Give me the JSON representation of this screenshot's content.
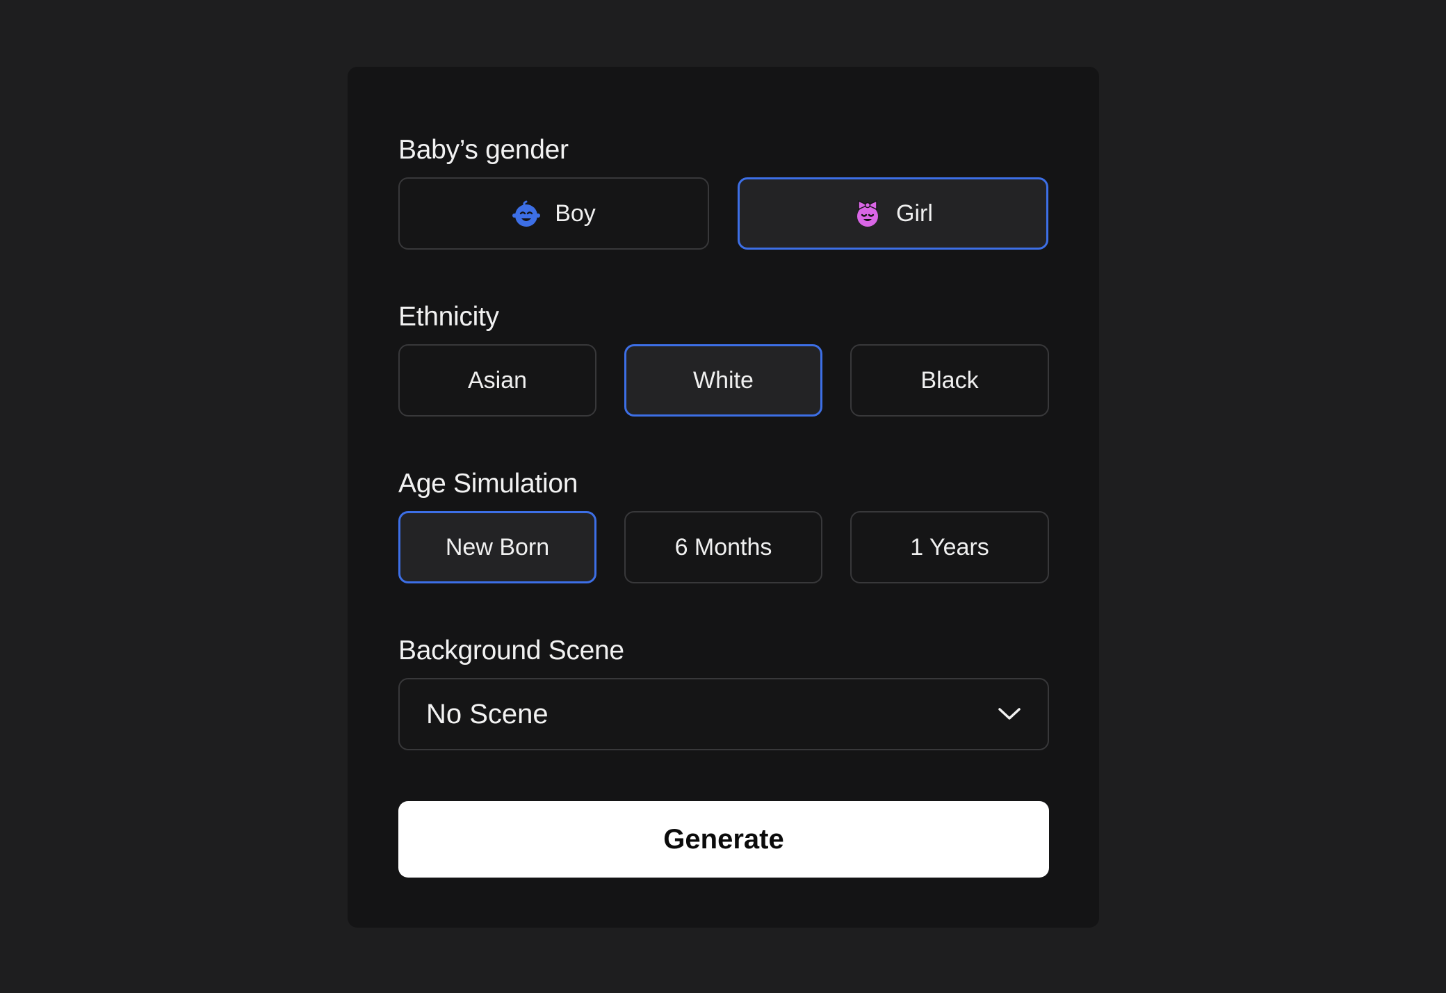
{
  "gender": {
    "label": "Baby’s gender",
    "options": [
      {
        "label": "Boy",
        "icon": "baby-boy-icon",
        "selected": false
      },
      {
        "label": "Girl",
        "icon": "baby-girl-icon",
        "selected": true
      }
    ]
  },
  "ethnicity": {
    "label": "Ethnicity",
    "options": [
      {
        "label": "Asian",
        "selected": false
      },
      {
        "label": "White",
        "selected": true
      },
      {
        "label": "Black",
        "selected": false
      }
    ]
  },
  "age": {
    "label": "Age Simulation",
    "options": [
      {
        "label": "New Born",
        "selected": true
      },
      {
        "label": "6 Months",
        "selected": false
      },
      {
        "label": "1 Years",
        "selected": false
      }
    ]
  },
  "scene": {
    "label": "Background Scene",
    "value": "No Scene",
    "icon": "chevron-down-icon"
  },
  "generate": {
    "label": "Generate"
  },
  "colors": {
    "background": "#1e1e1f",
    "panel": "#141415",
    "accent": "#3d6fe6",
    "boy_icon": "#3d6fe6",
    "girl_icon": "#d966e6"
  }
}
